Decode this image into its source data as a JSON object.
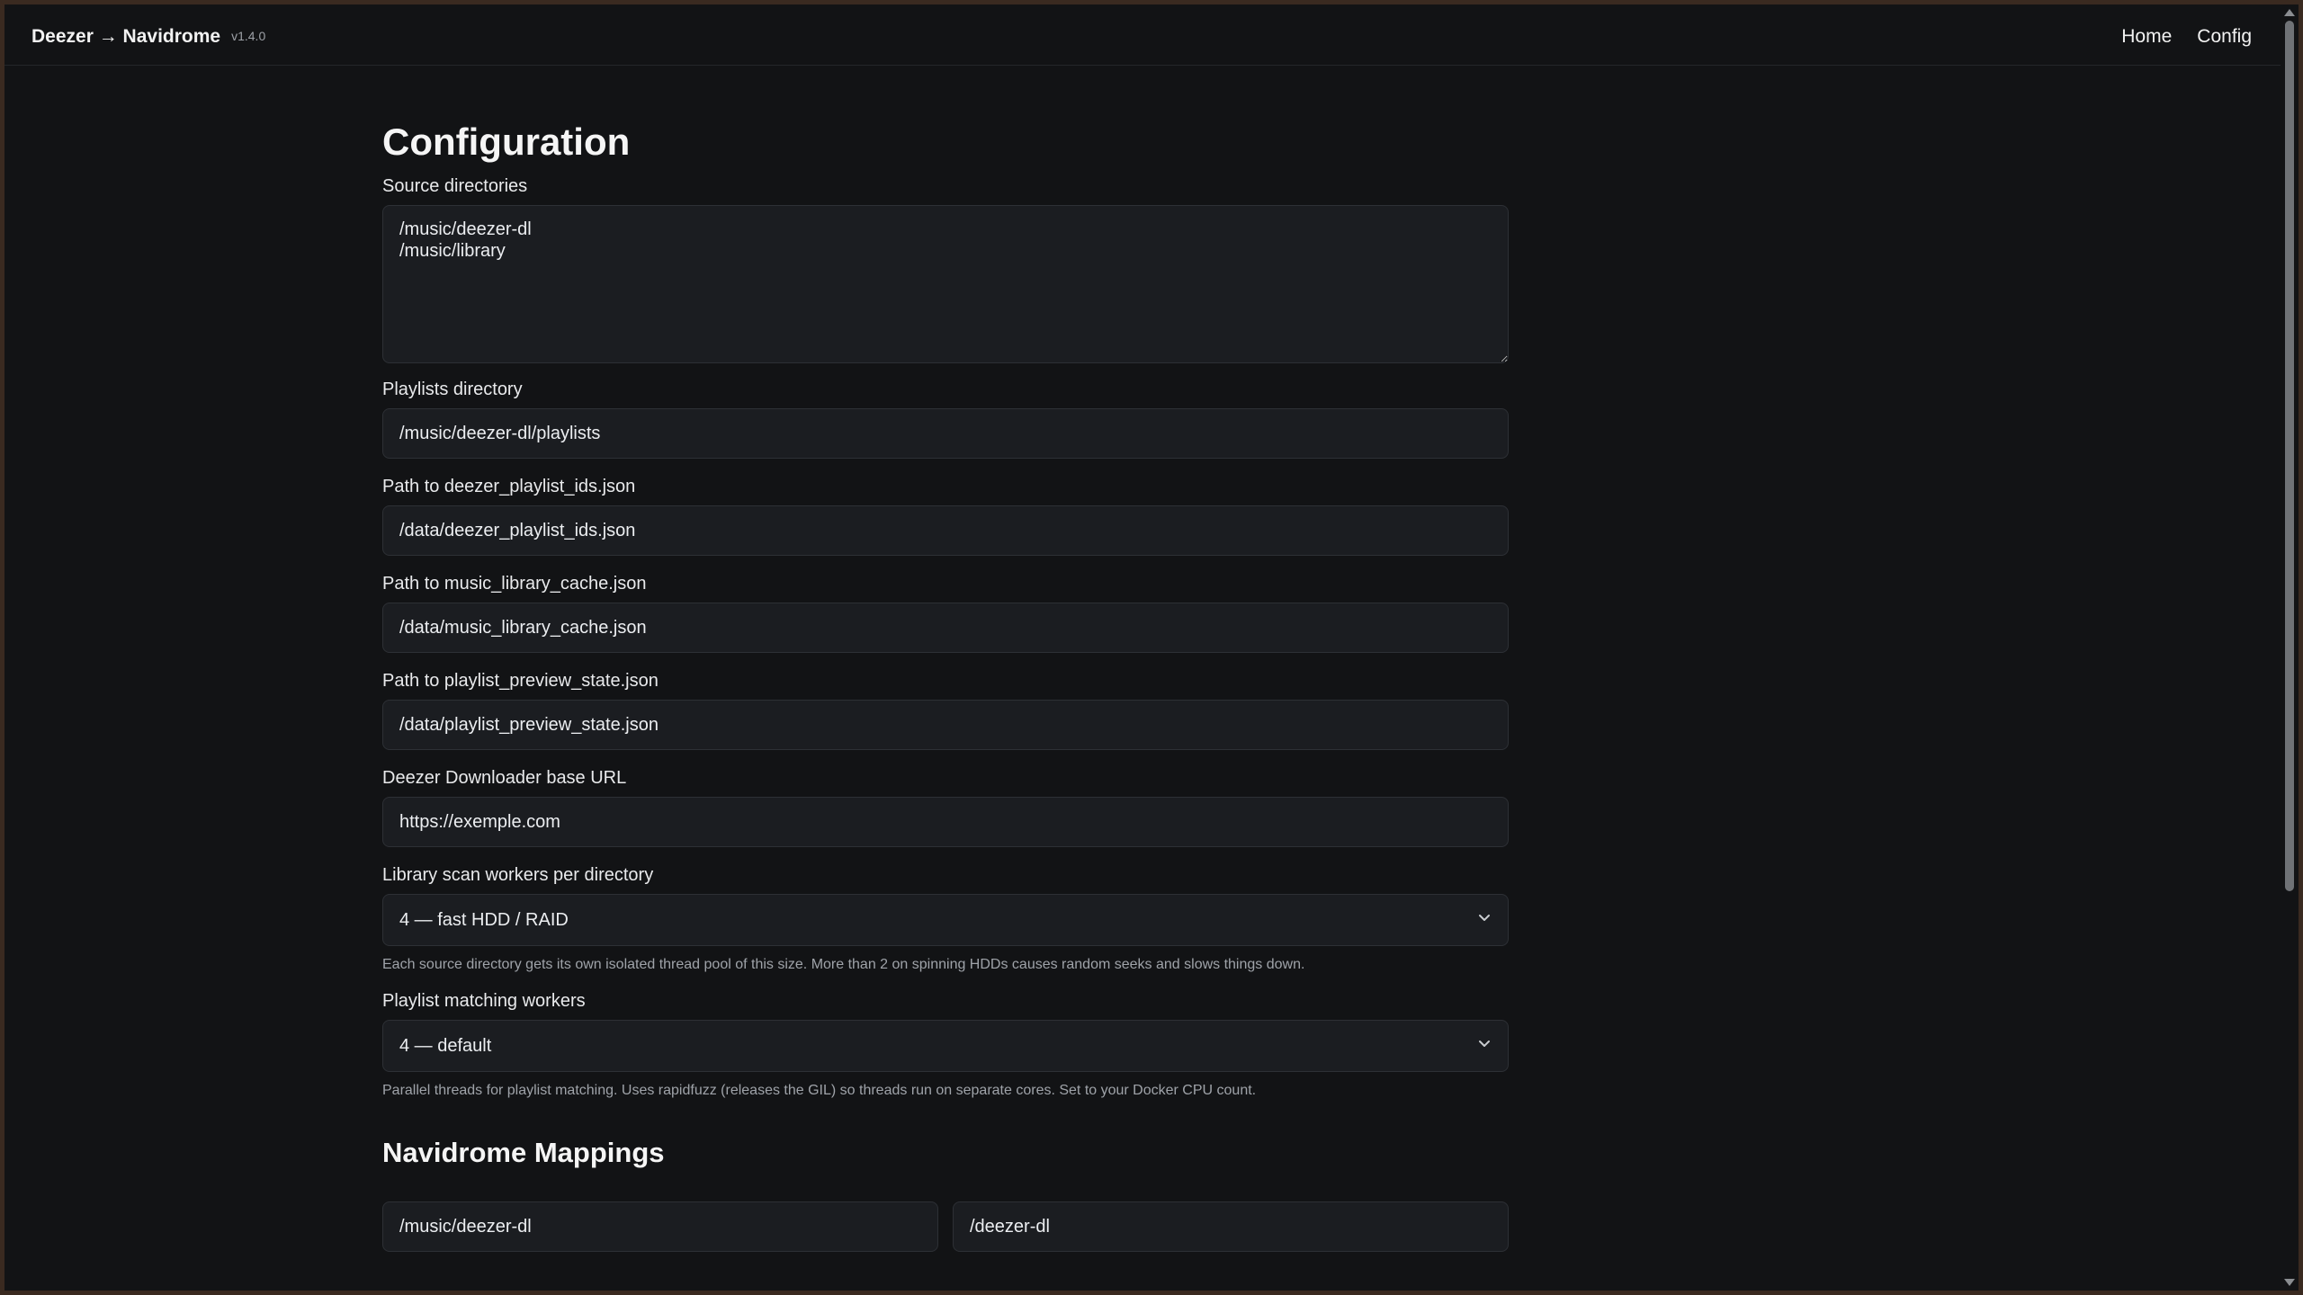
{
  "header": {
    "brand": "Deezer → Navidrome",
    "version": "v1.4.0",
    "nav": {
      "home": "Home",
      "config": "Config"
    }
  },
  "page": {
    "title": "Configuration"
  },
  "fields": {
    "source_directories": {
      "label": "Source directories",
      "value": "/music/deezer-dl\n/music/library"
    },
    "playlists_directory": {
      "label": "Playlists directory",
      "value": "/music/deezer-dl/playlists"
    },
    "playlist_ids_path": {
      "label": "Path to deezer_playlist_ids.json",
      "value": "/data/deezer_playlist_ids.json"
    },
    "library_cache_path": {
      "label": "Path to music_library_cache.json",
      "value": "/data/music_library_cache.json"
    },
    "preview_state_path": {
      "label": "Path to playlist_preview_state.json",
      "value": "/data/playlist_preview_state.json"
    },
    "downloader_base_url": {
      "label": "Deezer Downloader base URL",
      "value": "https://exemple.com"
    },
    "scan_workers": {
      "label": "Library scan workers per directory",
      "selected": "4 — fast HDD / RAID",
      "help": "Each source directory gets its own isolated thread pool of this size. More than 2 on spinning HDDs causes random seeks and slows things down."
    },
    "matching_workers": {
      "label": "Playlist matching workers",
      "selected": "4 — default",
      "help": "Parallel threads for playlist matching. Uses rapidfuzz (releases the GIL) so threads run on separate cores. Set to your Docker CPU count."
    }
  },
  "mappings": {
    "title": "Navidrome Mappings",
    "rows": [
      {
        "source": "/music/deezer-dl",
        "target": "/deezer-dl"
      }
    ]
  },
  "icons": {
    "select_chevron": "chevron-down-icon",
    "scroll_up": "scroll-up-arrow-icon",
    "scroll_down": "scroll-down-arrow-icon"
  },
  "colors": {
    "background": "#121315",
    "input_background": "#1b1d21",
    "input_border": "#2d3035",
    "text": "#eceef1",
    "muted_text": "#9fa3a9"
  }
}
